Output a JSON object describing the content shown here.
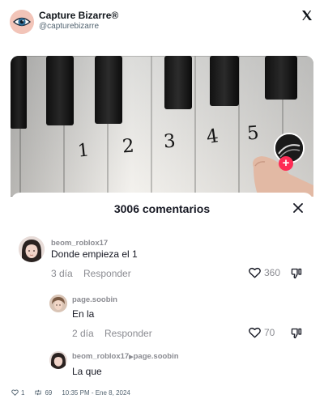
{
  "tweet": {
    "display_name": "Capture Bizarre®",
    "handle": "@capturebizarre",
    "close_icon": "x-logo-icon"
  },
  "media": {
    "key_numbers": [
      "1",
      "2",
      "3",
      "4",
      "5"
    ]
  },
  "comments_panel": {
    "title": "3006 comentarios",
    "close_icon": "close-icon",
    "comments": [
      {
        "username": "beom_roblox17",
        "text": "Donde empieza el 1",
        "age": "3 día",
        "reply_label": "Responder",
        "likes": "360"
      },
      {
        "username": "page.soobin",
        "text": "En la",
        "age": "2 día",
        "reply_label": "Responder",
        "likes": "70"
      },
      {
        "username": "beom_roblox17",
        "reply_to": "page.soobin",
        "text": "La que"
      }
    ]
  },
  "footer": {
    "likes": "1",
    "retweets": "69",
    "timestamp": "10:35 PM - Ene 8, 2024"
  },
  "colors": {
    "accent_red": "#fe2c55",
    "muted_text": "#8a8b91"
  }
}
